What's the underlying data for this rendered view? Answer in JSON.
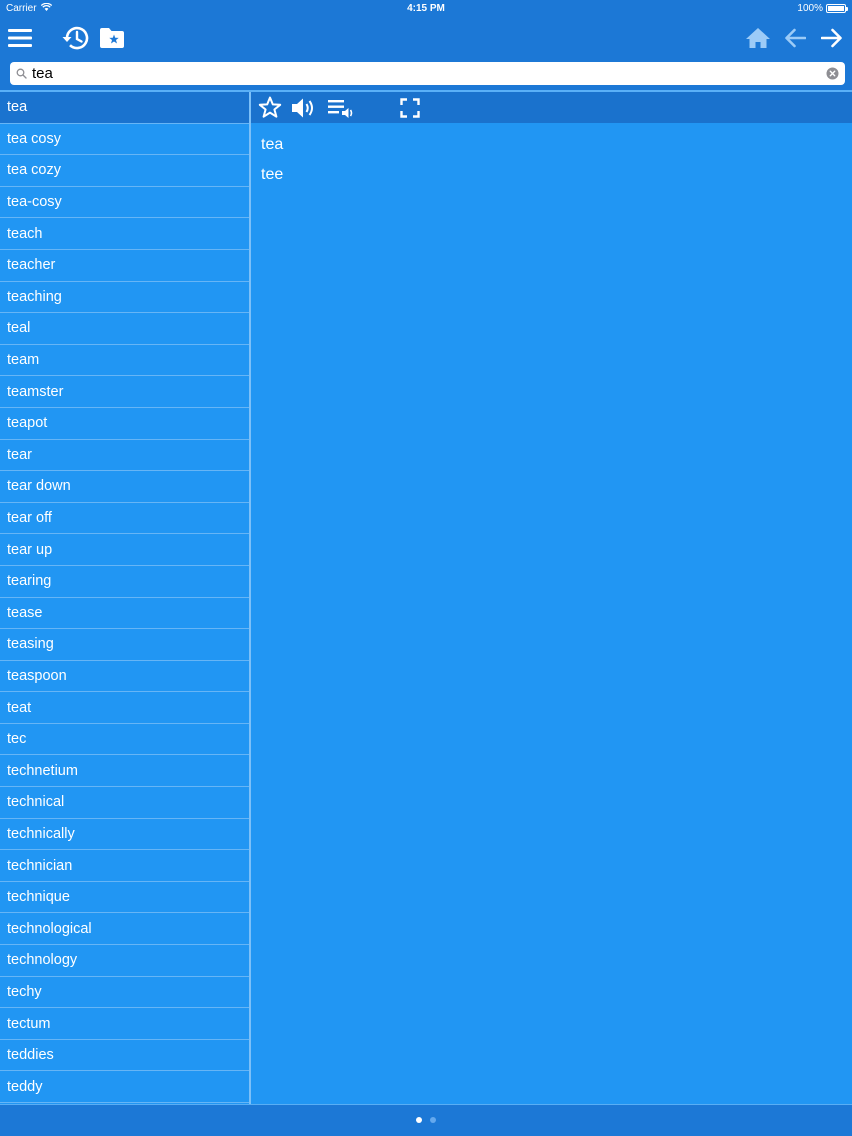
{
  "status_bar": {
    "carrier": "Carrier",
    "time": "4:15 PM",
    "battery": "100%"
  },
  "toolbar": {
    "menu_icon": "hamburger-menu-icon",
    "history_icon": "history-icon",
    "bookmarks_icon": "bookmark-folder-icon",
    "home_icon": "home-icon",
    "back_icon": "arrow-left-icon",
    "forward_icon": "arrow-right-icon"
  },
  "search": {
    "value": "tea",
    "placeholder": ""
  },
  "word_list": {
    "selected": "tea",
    "items": [
      "tea",
      "tea cosy",
      "tea cozy",
      "tea-cosy",
      "teach",
      "teacher",
      "teaching",
      "teal",
      "team",
      "teamster",
      "teapot",
      "tear",
      "tear down",
      "tear off",
      "tear up",
      "tearing",
      "tease",
      "teasing",
      "teaspoon",
      "teat",
      "tec",
      "technetium",
      "technical",
      "technically",
      "technician",
      "technique",
      "technological",
      "technology",
      "techy",
      "tectum",
      "teddies",
      "teddy"
    ]
  },
  "detail_toolbar": {
    "favorite_icon": "star-outline-icon",
    "speaker_icon": "speaker-icon",
    "playlist_icon": "playlist-audio-icon",
    "fullscreen_icon": "fullscreen-icon"
  },
  "detail": {
    "lines": [
      "tea",
      "tee"
    ]
  },
  "pager": {
    "pages": 2,
    "current": 1
  },
  "colors": {
    "toolbar": "#1c78d6",
    "list_bg": "#2196f3",
    "selected_row": "#1a73cf",
    "separator": "#66b5f6"
  }
}
